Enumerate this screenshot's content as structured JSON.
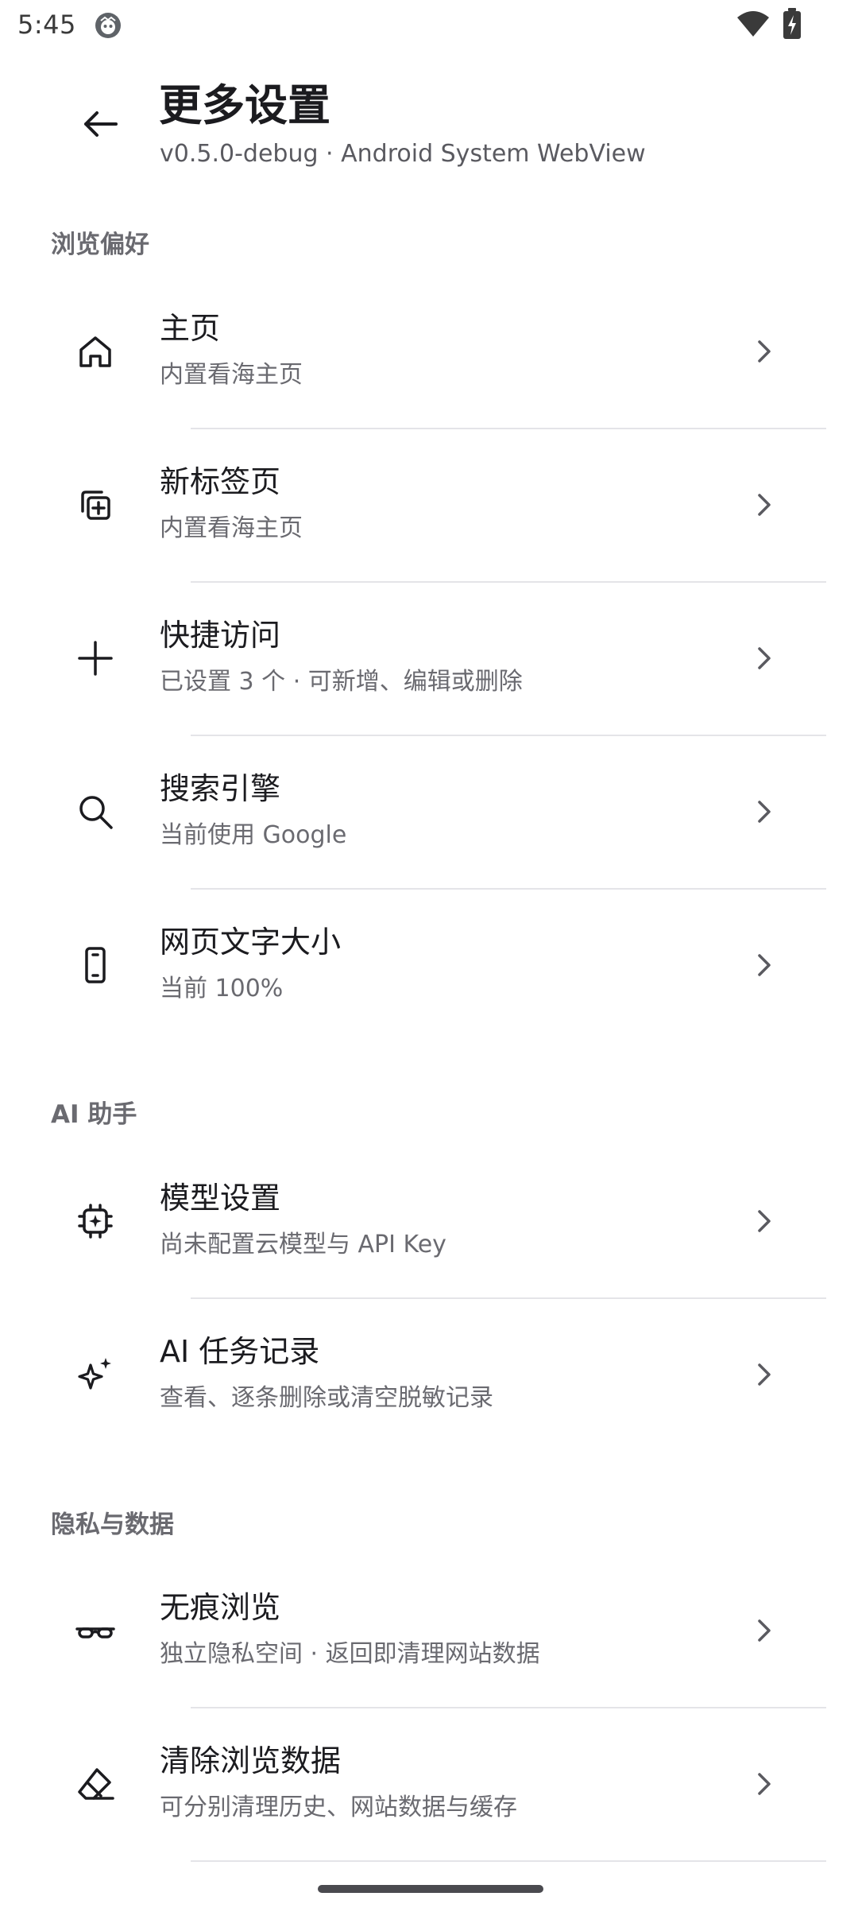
{
  "status_bar": {
    "time": "5:45"
  },
  "header": {
    "title": "更多设置",
    "subtitle": "v0.5.0-debug · Android System WebView"
  },
  "sections": [
    {
      "header": "浏览偏好",
      "items": [
        {
          "title": "主页",
          "subtitle": "内置看海主页",
          "icon": "home-icon"
        },
        {
          "title": "新标签页",
          "subtitle": "内置看海主页",
          "icon": "new-tab-icon"
        },
        {
          "title": "快捷访问",
          "subtitle": "已设置 3 个 · 可新增、编辑或删除",
          "icon": "plus-icon"
        },
        {
          "title": "搜索引擎",
          "subtitle": "当前使用 Google",
          "icon": "search-icon"
        },
        {
          "title": "网页文字大小",
          "subtitle": "当前 100%",
          "icon": "phone-icon"
        }
      ]
    },
    {
      "header": "AI 助手",
      "items": [
        {
          "title": "模型设置",
          "subtitle": "尚未配置云模型与 API Key",
          "icon": "chip-icon"
        },
        {
          "title": "AI 任务记录",
          "subtitle": "查看、逐条删除或清空脱敏记录",
          "icon": "sparkle-icon"
        }
      ]
    },
    {
      "header": "隐私与数据",
      "items": [
        {
          "title": "无痕浏览",
          "subtitle": "独立隐私空间 · 返回即清理网站数据",
          "icon": "incognito-glasses-icon"
        },
        {
          "title": "清除浏览数据",
          "subtitle": "可分别清理历史、网站数据与缓存",
          "icon": "eraser-icon"
        }
      ]
    }
  ],
  "colors": {
    "primary_text": "#1b1b1f",
    "secondary_text": "#6a6a70",
    "divider": "#e4e4e8",
    "background": "#ffffff"
  }
}
